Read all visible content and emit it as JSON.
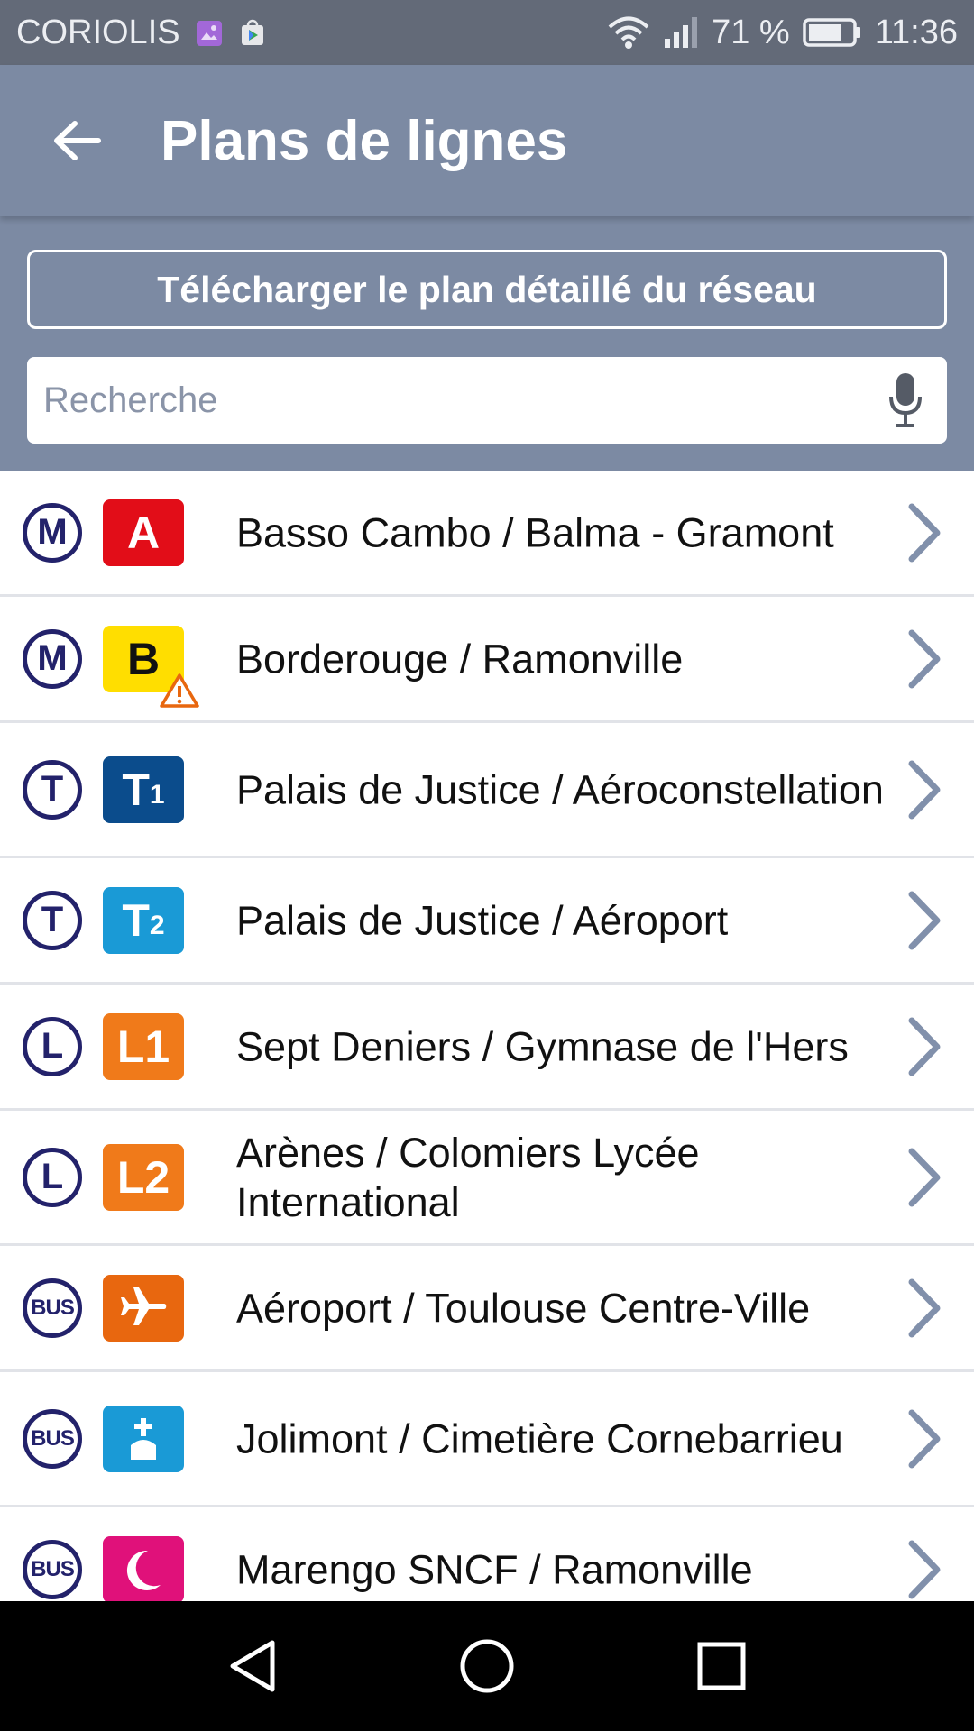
{
  "status_bar": {
    "carrier": "CORIOLIS",
    "battery_percent": "71 %",
    "time": "11:36",
    "icons": [
      "gallery-icon",
      "play-store-icon",
      "wifi-icon",
      "signal-icon",
      "battery-icon"
    ]
  },
  "app_bar": {
    "title": "Plans de lignes",
    "back_icon": "arrow-left-icon"
  },
  "header": {
    "download_label": "Télécharger le plan détaillé du réseau",
    "search_placeholder": "Recherche",
    "search_value": "",
    "mic_icon": "microphone-icon"
  },
  "lines": [
    {
      "mode": "M",
      "badge": "A",
      "badge_sub": "",
      "badge_color": "#e20d18",
      "badge_text_color": "#ffffff",
      "label": "Basso Cambo / Balma - Gramont",
      "warning": false
    },
    {
      "mode": "M",
      "badge": "B",
      "badge_sub": "",
      "badge_color": "#ffde00",
      "badge_text_color": "#111111",
      "label": "Borderouge / Ramonville",
      "warning": true
    },
    {
      "mode": "T",
      "badge": "T",
      "badge_sub": "1",
      "badge_color": "#0b4c8c",
      "badge_text_color": "#ffffff",
      "label": "Palais de Justice / Aéroconstellation",
      "warning": false
    },
    {
      "mode": "T",
      "badge": "T",
      "badge_sub": "2",
      "badge_color": "#1a9ad6",
      "badge_text_color": "#ffffff",
      "label": "Palais de Justice / Aéroport",
      "warning": false
    },
    {
      "mode": "L",
      "badge": "L1",
      "badge_sub": "",
      "badge_color": "#f07a1a",
      "badge_text_color": "#ffffff",
      "label": "Sept Deniers / Gymnase de l'Hers",
      "warning": false
    },
    {
      "mode": "L",
      "badge": "L2",
      "badge_sub": "",
      "badge_color": "#f07a1a",
      "badge_text_color": "#ffffff",
      "label": "Arènes / Colomiers Lycée International",
      "warning": false
    },
    {
      "mode": "BUS",
      "badge": "airplane-icon",
      "badge_sub": "",
      "badge_color": "#e8670f",
      "badge_text_color": "#ffffff",
      "label": "Aéroport / Toulouse Centre-Ville",
      "warning": false
    },
    {
      "mode": "BUS",
      "badge": "cemetery-cross-icon",
      "badge_sub": "",
      "badge_color": "#1a9ad6",
      "badge_text_color": "#ffffff",
      "label": "Jolimont / Cimetière Cornebarrieu",
      "warning": false
    },
    {
      "mode": "BUS",
      "badge": "crescent-moon-icon",
      "badge_sub": "",
      "badge_color": "#e0117a",
      "badge_text_color": "#ffffff",
      "label": "Marengo SNCF / Ramonville",
      "warning": false
    }
  ],
  "colors": {
    "primary": "#7c8aa3",
    "status_bar": "#636a78",
    "mode_circle": "#23226b",
    "chevron": "#8190ab",
    "warning": "#e8670f"
  },
  "nav_bar": {
    "icons": [
      "back-triangle-icon",
      "home-circle-icon",
      "recents-square-icon"
    ]
  }
}
